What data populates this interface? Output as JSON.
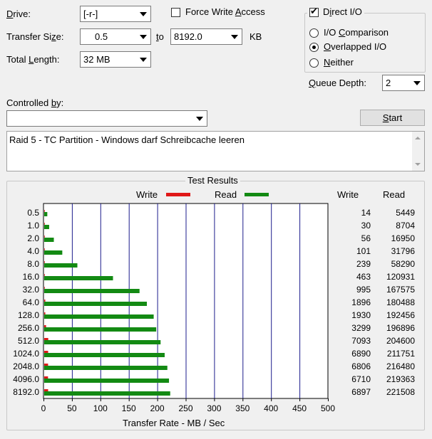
{
  "controls": {
    "drive_label_pre": "",
    "drive_label_u": "D",
    "drive_label_post": "rive:",
    "drive_value": "[-r-]",
    "transfer_size_label_pre": "Transfer Si",
    "transfer_size_label_u": "z",
    "transfer_size_label_post": "e:",
    "transfer_from": "0.5",
    "to_label_pre": "",
    "to_label_u": "t",
    "to_label_post": "o",
    "transfer_to": "8192.0",
    "kb_label": "KB",
    "total_length_label_pre": "Total ",
    "total_length_label_u": "L",
    "total_length_label_post": "ength:",
    "total_length_value": "32 MB",
    "force_write_pre": "Force Write ",
    "force_write_u": "A",
    "force_write_post": "ccess",
    "force_write_checked": false,
    "direct_io_pre": "D",
    "direct_io_u": "i",
    "direct_io_post": "rect I/O",
    "direct_io_checked": true,
    "io_comparison_pre": "I/O ",
    "io_comparison_u": "C",
    "io_comparison_post": "omparison",
    "overlapped_pre": "",
    "overlapped_u": "O",
    "overlapped_post": "verlapped I/O",
    "neither_pre": "",
    "neither_u": "N",
    "neither_post": "either",
    "selected_mode": "overlapped",
    "queue_depth_label_pre": "",
    "queue_depth_label_u": "Q",
    "queue_depth_label_post": "ueue Depth:",
    "queue_depth_value": "2",
    "controlled_by_label_pre": "Controlled ",
    "controlled_by_label_u": "b",
    "controlled_by_label_post": "y:",
    "controlled_by_value": "",
    "start_pre": "",
    "start_u": "S",
    "start_post": "tart",
    "description": "Raid 5 - TC Partition - Windows darf Schreibcache leeren"
  },
  "results": {
    "group_title": "Test Results",
    "legend_write": "Write",
    "legend_read": "Read",
    "col_write": "Write",
    "col_read": "Read",
    "xlabel": "Transfer Rate - MB / Sec"
  },
  "colors": {
    "write": "#e01818",
    "read": "#138a13",
    "grid": "#1c1c8c"
  },
  "chart_data": {
    "type": "bar",
    "orientation": "horizontal",
    "title": "Test Results",
    "xlabel": "Transfer Rate - MB / Sec",
    "xlim": [
      0,
      500
    ],
    "xticks": [
      0,
      50,
      100,
      150,
      200,
      250,
      300,
      350,
      400,
      450,
      500
    ],
    "categories": [
      "0.5",
      "1.0",
      "2.0",
      "4.0",
      "8.0",
      "16.0",
      "32.0",
      "64.0",
      "128.0",
      "256.0",
      "512.0",
      "1024.0",
      "2048.0",
      "4096.0",
      "8192.0"
    ],
    "series": [
      {
        "name": "Write",
        "values": [
          14,
          30,
          56,
          101,
          239,
          463,
          995,
          1896,
          1930,
          3299,
          7093,
          6890,
          6806,
          6710,
          6897
        ]
      },
      {
        "name": "Read",
        "values": [
          5449,
          8704,
          16950,
          31796,
          58290,
          120931,
          167575,
          180488,
          192456,
          196896,
          204600,
          211751,
          216480,
          219363,
          221508
        ]
      }
    ],
    "value_unit": "KB/s",
    "grid": true
  }
}
